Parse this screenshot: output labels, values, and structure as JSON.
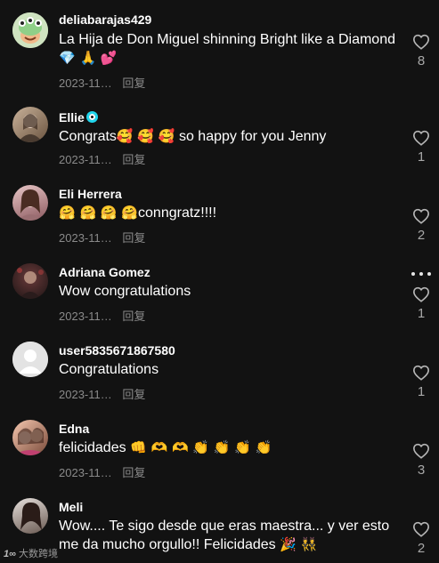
{
  "comments": [
    {
      "username": "deliabarajas429",
      "text": "La Hija de Don Miguel shinning Bright like a Diamond",
      "emojis": "💎 🙏 💕",
      "date": "2023-11…",
      "reply": "回复",
      "likes": "8",
      "avatar": "alien-cartoon-avatar"
    },
    {
      "username": "Ellie",
      "text": "Congrats",
      "emojis": "🥰 🥰 🥰",
      "text_after": " so happy for you Jenny",
      "date": "2023-11…",
      "reply": "回复",
      "likes": "1",
      "avatar": "photo-avatar"
    },
    {
      "username": "Eli Herrera",
      "emojis": "🤗 🤗 🤗 🤗",
      "text": "conngratz!!!!",
      "date": "2023-11…",
      "reply": "回复",
      "likes": "2",
      "avatar": "photo-avatar"
    },
    {
      "username": "Adriana Gomez",
      "text": "Wow congratulations",
      "date": "2023-11…",
      "reply": "回复",
      "likes": "1",
      "avatar": "photo-avatar"
    },
    {
      "username": "user5835671867580",
      "text": "Congratulations",
      "date": "2023-11…",
      "reply": "回复",
      "likes": "1",
      "avatar": "default-avatar"
    },
    {
      "username": "Edna",
      "text": "felicidades",
      "emojis": "👊 🫶 🫶 👏 👏 👏 👏",
      "date": "2023-11…",
      "reply": "回复",
      "likes": "3",
      "avatar": "photo-avatar"
    },
    {
      "username": "Meli",
      "text": "Wow.... Te sigo desde que eras maestra... y ver esto me da mucho orgullo!! Felicidades",
      "emojis": "🎉 👯",
      "date": "2023-11…",
      "reply": "回复",
      "likes": "2",
      "avatar": "photo-avatar"
    }
  ],
  "watermark": {
    "logo": "1∞",
    "text": "大数跨境"
  },
  "colors": {
    "background": "#121212",
    "muted": "#8a8a8a",
    "verified": "#20d5ec"
  },
  "icons": {
    "like": "heart-outline-icon",
    "more": "more-dots-icon",
    "verified": "verified-badge-icon"
  }
}
